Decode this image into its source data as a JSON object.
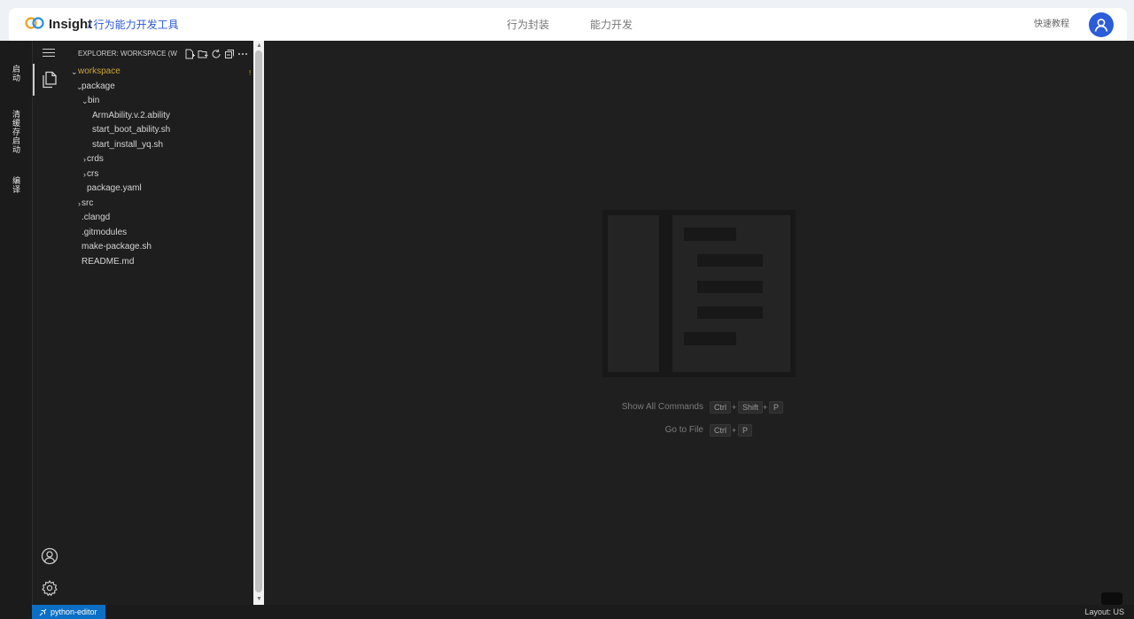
{
  "header": {
    "app_name": "Insight",
    "app_subtitle": "/ 行为能力开发工具",
    "nav": [
      "行为封装",
      "能力开发"
    ],
    "quick_guide": "快速教程",
    "accent_color": "#2b5cd9"
  },
  "left_strip": {
    "items": [
      "启动",
      "清缓存启动",
      "编译"
    ]
  },
  "activity_bar": {
    "icons": [
      "explorer-icon",
      "account-icon",
      "settings-gear-icon"
    ]
  },
  "sidebar": {
    "title": "EXPLORER: WORKSPACE (W...",
    "toolbar_icons": [
      "new-file-icon",
      "new-folder-icon",
      "refresh-icon",
      "collapse-all-icon",
      "more-icon"
    ],
    "root_marker": "!",
    "tree": [
      {
        "label": "workspace",
        "chevron": "⌄"
      },
      {
        "label": "package",
        "chevron": "⌄"
      },
      {
        "label": "bin",
        "chevron": "⌄"
      },
      {
        "label": "ArmAbility.v.2.ability",
        "chevron": ""
      },
      {
        "label": "start_boot_ability.sh",
        "chevron": ""
      },
      {
        "label": "start_install_yq.sh",
        "chevron": ""
      },
      {
        "label": "crds",
        "chevron": "›"
      },
      {
        "label": "crs",
        "chevron": "›"
      },
      {
        "label": "package.yaml",
        "chevron": ""
      },
      {
        "label": "src",
        "chevron": "›"
      },
      {
        "label": ".clangd",
        "chevron": ""
      },
      {
        "label": ".gitmodules",
        "chevron": ""
      },
      {
        "label": "make-package.sh",
        "chevron": ""
      },
      {
        "label": "README.md",
        "chevron": ""
      }
    ]
  },
  "editor": {
    "shortcuts": [
      {
        "label": "Show All Commands",
        "keys": [
          "Ctrl",
          "Shift",
          "P"
        ]
      },
      {
        "label": "Go to File",
        "keys": [
          "Ctrl",
          "P"
        ]
      }
    ]
  },
  "statusbar": {
    "remote": "python-editor",
    "remote_color": "#0b6fc5",
    "layout": "Layout: US"
  }
}
